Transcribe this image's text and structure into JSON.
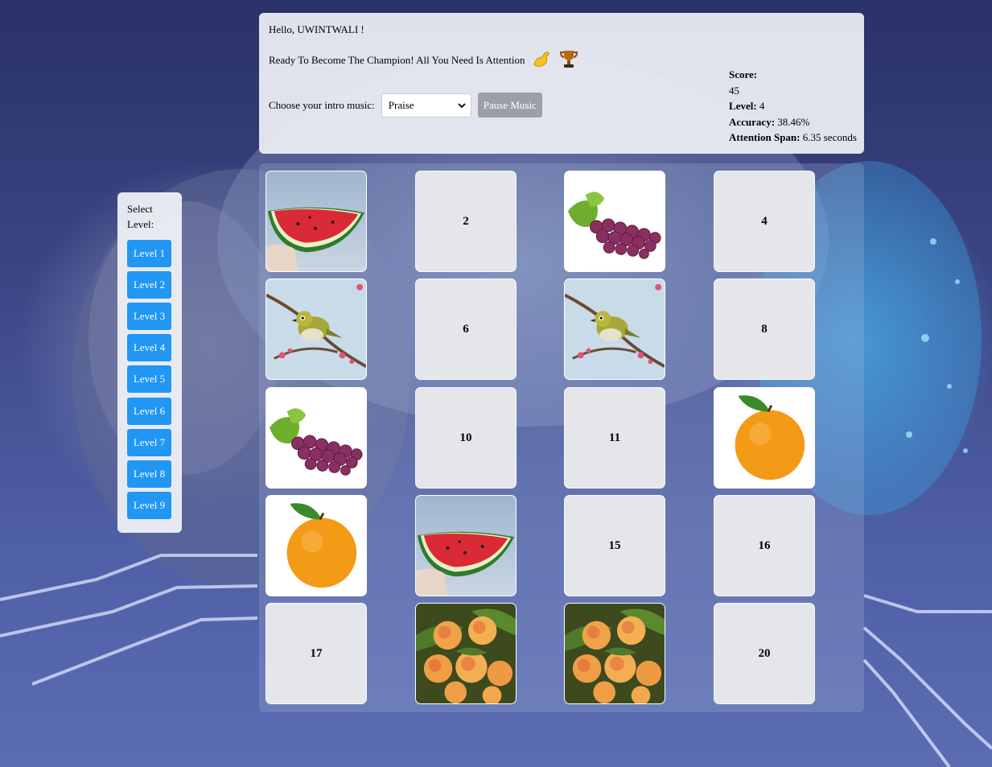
{
  "header": {
    "greeting": "Hello, UWINTWALI !",
    "tagline": "Ready To Become The Champion! All You Need Is Attention",
    "emoji_1": "💪",
    "emoji_2": "🏆",
    "music_label": "Choose your intro music:",
    "music_selected": "Praise",
    "pause_label": "Pause Music"
  },
  "stats": {
    "score_label": "Score:",
    "score_value": "45",
    "level_label": "Level:",
    "level_value": "4",
    "accuracy_label": "Accuracy:",
    "accuracy_value": "38.46%",
    "attention_label": "Attention Span:",
    "attention_value": "6.35 seconds"
  },
  "sidebar": {
    "title": "Select Level:",
    "levels": [
      "Level 1",
      "Level 2",
      "Level 3",
      "Level 4",
      "Level 5",
      "Level 6",
      "Level 7",
      "Level 8",
      "Level 9"
    ]
  },
  "cards": [
    {
      "label": "",
      "image": "watermelon"
    },
    {
      "label": "2",
      "image": ""
    },
    {
      "label": "",
      "image": "grapes"
    },
    {
      "label": "4",
      "image": ""
    },
    {
      "label": "",
      "image": "bird"
    },
    {
      "label": "6",
      "image": ""
    },
    {
      "label": "",
      "image": "bird"
    },
    {
      "label": "8",
      "image": ""
    },
    {
      "label": "",
      "image": "grapes"
    },
    {
      "label": "10",
      "image": ""
    },
    {
      "label": "11",
      "image": ""
    },
    {
      "label": "",
      "image": "orange"
    },
    {
      "label": "",
      "image": "orange"
    },
    {
      "label": "",
      "image": "watermelon"
    },
    {
      "label": "15",
      "image": ""
    },
    {
      "label": "16",
      "image": ""
    },
    {
      "label": "17",
      "image": ""
    },
    {
      "label": "",
      "image": "peaches"
    },
    {
      "label": "",
      "image": "peaches"
    },
    {
      "label": "20",
      "image": ""
    }
  ],
  "colors": {
    "level_button": "#2196f3",
    "pause_button": "#9a9fa8",
    "card_back": "#e5e6ea"
  }
}
